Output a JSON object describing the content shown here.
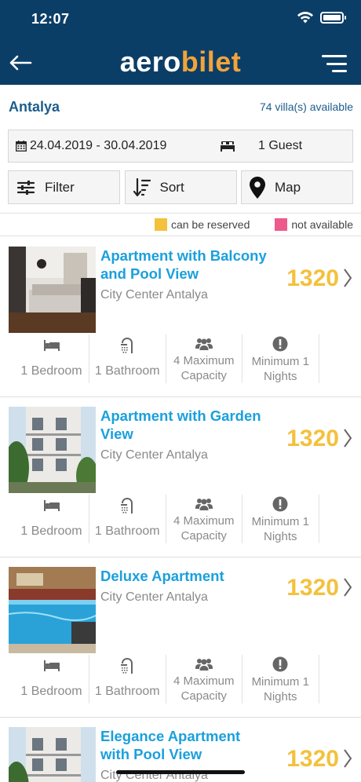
{
  "status": {
    "time": "12:07"
  },
  "header": {
    "logo_primary": "aero",
    "logo_accent": "bilet",
    "brand_color": "#0b3e67",
    "accent_color": "#f2a33a"
  },
  "location": {
    "city": "Antalya",
    "available": "74 villa(s) available"
  },
  "search": {
    "dates": "24.04.2019 - 30.04.2019",
    "guests": "1 Guest"
  },
  "actions": {
    "filter": "Filter",
    "sort": "Sort",
    "map": "Map"
  },
  "legend": {
    "reservable": "can be reserved",
    "unavailable": "not available",
    "reservable_color": "#f3c13c",
    "unavailable_color": "#ee5a8a"
  },
  "listings": [
    {
      "title": "Apartment with Balcony and Pool View",
      "location": "City Center Antalya",
      "price": "1320",
      "features": {
        "bedroom": "1 Bedroom",
        "bathroom": "1 Bathroom",
        "capacity": "4 Maximum Capacity",
        "min_nights": "Minimum 1 Nights"
      }
    },
    {
      "title": "Apartment with Garden View",
      "location": "City Center Antalya",
      "price": "1320",
      "features": {
        "bedroom": "1 Bedroom",
        "bathroom": "1 Bathroom",
        "capacity": "4 Maximum Capacity",
        "min_nights": "Minimum 1 Nights"
      }
    },
    {
      "title": "Deluxe Apartment",
      "location": "City Center Antalya",
      "price": "1320",
      "features": {
        "bedroom": "1 Bedroom",
        "bathroom": "1 Bathroom",
        "capacity": "4 Maximum Capacity",
        "min_nights": "Minimum 1 Nights"
      }
    },
    {
      "title": "Elegance Apartment with Pool View",
      "location": "City Center Antalya",
      "price": "1320"
    }
  ]
}
